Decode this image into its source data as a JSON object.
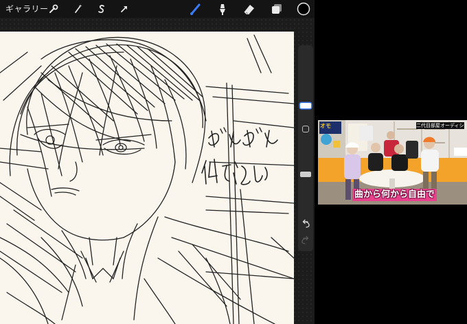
{
  "toolbar": {
    "gallery_label": "ギャラリー",
    "left_icons": [
      "wrench-icon",
      "magic-wand-icon",
      "selection-s-icon",
      "arrow-transform-icon"
    ],
    "right_icons": [
      "brush-icon",
      "smudge-icon",
      "eraser-icon",
      "layers-icon"
    ],
    "active_tool": "brush",
    "accent_color": "#3a7bf5",
    "current_color": "#000000"
  },
  "canvas": {
    "background_color": "#faf6ee",
    "handwritten_text_lines": [
      "ぜんぜん",
      "似てない"
    ]
  },
  "sidebar": {
    "brush_size_level": 0.45,
    "opacity_level": 0.3,
    "buttons": [
      "modify-square-button",
      "undo-icon",
      "redo-icon"
    ]
  },
  "video": {
    "caption": "曲から何から自由で",
    "title_strip": "二代目部屋オーディション",
    "logo_text": "オモ"
  }
}
